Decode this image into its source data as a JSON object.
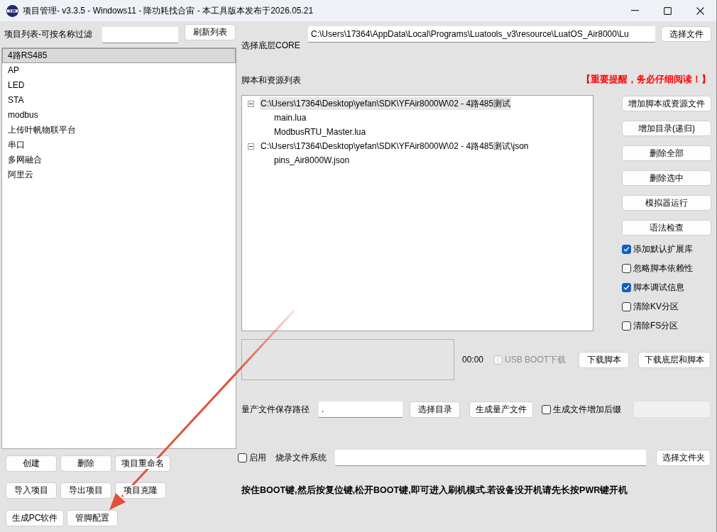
{
  "window": {
    "title": "项目管理- v3.3.5 - Windows11 - 降功耗找合宙 - 本工具版本发布于2026.05.21"
  },
  "project_panel": {
    "filter_label": "项目列表-可按名称过滤",
    "refresh_button": "刷新列表",
    "projects": [
      {
        "label": "4路RS485",
        "selected": true
      },
      {
        "label": "AP",
        "selected": false
      },
      {
        "label": "LED",
        "selected": false
      },
      {
        "label": "STA",
        "selected": false
      },
      {
        "label": "modbus",
        "selected": false
      },
      {
        "label": "上传叶帆物联平台",
        "selected": false
      },
      {
        "label": "串口",
        "selected": false
      },
      {
        "label": "多网融合",
        "selected": false
      },
      {
        "label": "阿里云",
        "selected": false
      }
    ],
    "button_rows": [
      [
        "创建",
        "删除",
        "项目重命名"
      ],
      [
        "导入项目",
        "导出项目",
        "项目克隆"
      ],
      [
        "生成PC软件",
        "管脚配置"
      ]
    ]
  },
  "core": {
    "label": "选择底层CORE",
    "path": "C:\\Users\\17364\\AppData\\Local\\Programs\\Luatools_v3\\resource\\LuatOS_Air8000\\Lu",
    "button": "选择文件"
  },
  "scripts": {
    "title": "脚本和资源列表",
    "notice": "【重要提醒，务必仔细阅读！】",
    "tree": [
      {
        "label": "C:\\Users\\17364\\Desktop\\yefan\\SDK\\YFAir8000W\\02 - 4路485测试",
        "expanded": true,
        "selected": true,
        "children": [
          {
            "label": "main.lua",
            "selected": false
          },
          {
            "label": "ModbusRTU_Master.lua",
            "selected": false
          }
        ]
      },
      {
        "label": "C:\\Users\\17364\\Desktop\\yefan\\SDK\\YFAir8000W\\02 - 4路485测试\\json",
        "expanded": true,
        "selected": false,
        "children": [
          {
            "label": "pins_Air8000W.json",
            "selected": false
          }
        ]
      }
    ],
    "actions": [
      "增加脚本或资源文件",
      "增加目录(递归)",
      "删除全部",
      "删除选中",
      "模拟器运行",
      "语法检查"
    ],
    "options": [
      {
        "label": "添加默认扩展库",
        "checked": true
      },
      {
        "label": "忽略脚本依赖性",
        "checked": false
      },
      {
        "label": "脚本调试信息",
        "checked": true
      },
      {
        "label": "清除KV分区",
        "checked": false
      },
      {
        "label": "清除FS分区",
        "checked": false
      }
    ]
  },
  "download": {
    "timer": "00:00",
    "usb_boot": {
      "label": "USB BOOT下载",
      "checked": false,
      "disabled": true
    },
    "buttons": [
      "下载脚本",
      "下载底层和脚本"
    ]
  },
  "mass_production": {
    "label": "量产文件保存路径",
    "path": ".",
    "buttons": [
      "选择目录",
      "生成量产文件"
    ],
    "suffix_option": {
      "label": "生成文件增加后缀",
      "checked": false
    },
    "suffix_field": {
      "disabled": true
    }
  },
  "filesystem": {
    "enable": {
      "label": "启用",
      "checked": false
    },
    "label": "烧录文件系统",
    "button": "选择文件夹"
  },
  "hint": "按住BOOT键,然后按复位键,松开BOOT键,即可进入刷机模式.若设备没开机请先长按PWR键开机",
  "annotations": [
    {
      "kind": "arrow"
    }
  ]
}
